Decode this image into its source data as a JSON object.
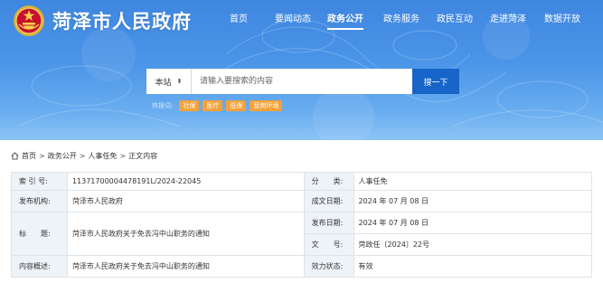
{
  "header": {
    "site_title": "菏泽市人民政府",
    "nav": [
      {
        "label": "首页"
      },
      {
        "label": "要闻动态"
      },
      {
        "label": "政务公开",
        "active": true
      },
      {
        "label": "政务服务"
      },
      {
        "label": "政民互动"
      },
      {
        "label": "走进菏泽"
      },
      {
        "label": "数据开放"
      }
    ]
  },
  "search": {
    "scope": "本站",
    "placeholder": "请输入要搜索的内容",
    "button": "搜一下"
  },
  "hot_search": {
    "label": "热搜词:",
    "tags": [
      "社保",
      "医疗",
      "低保",
      "营商环境"
    ],
    "tag_color": "#f3a23a"
  },
  "breadcrumb": [
    "首页",
    "政务公开",
    "人事任免",
    "正文内容"
  ],
  "info": {
    "index_label": "索 引 号:",
    "index_value": "11371700004478191L/2024-22045",
    "category_label": "分　　类:",
    "category_value": "人事任免",
    "publisher_label": "发布机构:",
    "publisher_value": "菏泽市人民政府",
    "date_written_label": "成文日期:",
    "date_written_value": "2024 年 07 月 08 日",
    "title_label": "标　　题:",
    "title_value": "菏泽市人民政府关于免去冯中山职务的通知",
    "publish_date_label": "发布日期:",
    "publish_date_value": "2024 年 07 月 08 日",
    "doc_no_label": "文　　号:",
    "doc_no_value": "菏政任〔2024〕22号",
    "summary_label": "内容概述:",
    "summary_value": "菏泽市人民政府关于免去冯中山职务的通知",
    "status_label": "效力状态:",
    "status_value": "有效"
  },
  "colors": {
    "hero_top": "#3f86e0",
    "search_button": "#1865c9",
    "label_bg": "#eef3f8"
  }
}
